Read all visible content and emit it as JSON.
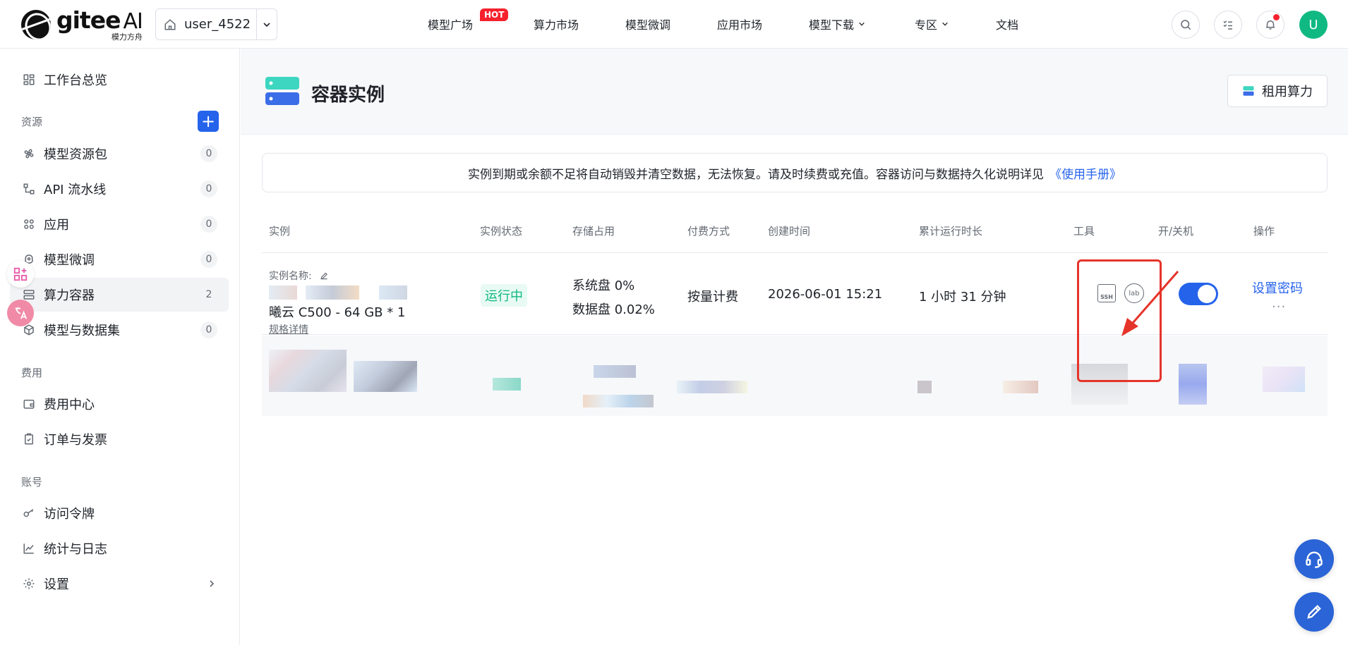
{
  "brand": {
    "name": "gitee",
    "ai": "AI",
    "sub": "模力方舟"
  },
  "user_select": {
    "name": "user_4522"
  },
  "nav": {
    "items": [
      "模型广场",
      "算力市场",
      "模型微调",
      "应用市场",
      "模型下载",
      "专区",
      "文档"
    ],
    "hot_badge": "HOT"
  },
  "avatar": {
    "letter": "U"
  },
  "sidebar": {
    "overview": "工作台总览",
    "section_resources": "资源",
    "resources": [
      {
        "label": "模型资源包",
        "count": "0"
      },
      {
        "label": "API 流水线",
        "count": "0"
      },
      {
        "label": "应用",
        "count": "0"
      },
      {
        "label": "模型微调",
        "count": "0"
      },
      {
        "label": "算力容器",
        "count": "2"
      },
      {
        "label": "模型与数据集",
        "count": "0"
      }
    ],
    "section_fees": "费用",
    "fees": [
      "费用中心",
      "订单与发票"
    ],
    "section_account": "账号",
    "account": [
      "访问令牌",
      "统计与日志",
      "设置"
    ]
  },
  "page": {
    "title": "容器实例",
    "rent_button": "租用算力",
    "notice": "实例到期或余额不足将自动销毁并清空数据，无法恢复。请及时续费或充值。容器访问与数据持久化说明详见",
    "notice_link": "《使用手册》"
  },
  "table": {
    "headers": [
      "实例",
      "实例状态",
      "存储占用",
      "付费方式",
      "创建时间",
      "累计运行时长",
      "工具",
      "开/关机",
      "操作"
    ],
    "row": {
      "name_label": "实例名称:",
      "spec": "曦云 C500 - 64 GB * 1",
      "spec_link": "规格详情",
      "status": "运行中",
      "storage_sys": "系统盘 0%",
      "storage_data": "数据盘 0.02%",
      "billing": "按量计费",
      "created": "2026-06-01 15:21",
      "duration": "1 小时 31 分钟",
      "tool_ssh": "SSH",
      "tool_lab": "lab",
      "op_link": "设置密码",
      "op_more": "···"
    }
  },
  "colors": {
    "accent": "#2563eb",
    "status": "#10b981",
    "highlight": "#e5342a"
  }
}
